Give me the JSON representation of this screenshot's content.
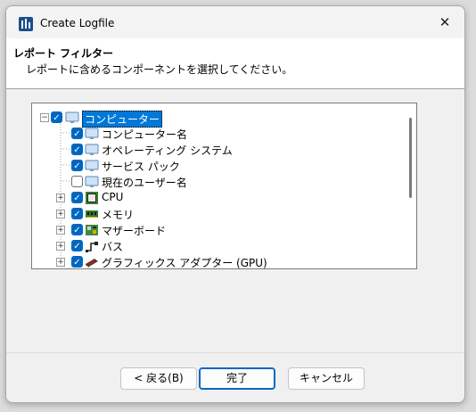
{
  "window": {
    "title": "Create Logfile"
  },
  "header": {
    "title": "レポート フィルター",
    "subtitle": "レポートに含めるコンポーネントを選択してください。"
  },
  "tree": {
    "root": {
      "label": "コンピューター",
      "checked": true,
      "expanded": true
    },
    "items": [
      {
        "label": "コンピューター名",
        "checked": true,
        "icon": "monitor-icon",
        "expandable": false
      },
      {
        "label": "オペレーティング システム",
        "checked": true,
        "icon": "monitor-icon",
        "expandable": false
      },
      {
        "label": "サービス パック",
        "checked": true,
        "icon": "monitor-icon",
        "expandable": false
      },
      {
        "label": "現在のユーザー名",
        "checked": false,
        "icon": "monitor-icon",
        "expandable": false
      },
      {
        "label": "CPU",
        "checked": true,
        "icon": "cpu-chip-icon",
        "expandable": true
      },
      {
        "label": "メモリ",
        "checked": true,
        "icon": "memory-stick-icon",
        "expandable": true
      },
      {
        "label": "マザーボード",
        "checked": true,
        "icon": "motherboard-icon",
        "expandable": true
      },
      {
        "label": "バス",
        "checked": true,
        "icon": "bus-connector-icon",
        "expandable": true
      },
      {
        "label": "グラフィックス アダプター (GPU)",
        "checked": true,
        "icon": "graphics-card-icon",
        "expandable": true
      }
    ]
  },
  "buttons": {
    "back": "< 戻る(B)",
    "finish": "完了",
    "cancel": "キャンセル"
  },
  "colors": {
    "accent": "#0067c0",
    "selection": "#0078d7"
  }
}
